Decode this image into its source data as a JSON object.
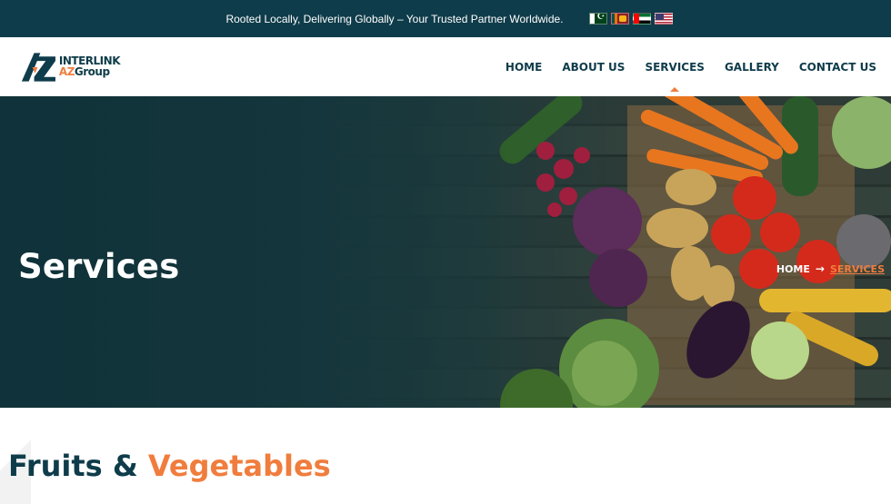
{
  "topbar": {
    "tagline": "Rooted Locally, Delivering Globally – Your Trusted Partner Worldwide.",
    "flags": [
      {
        "icon": "pakistan-flag-icon"
      },
      {
        "icon": "sri-lanka-flag-icon"
      },
      {
        "icon": "uae-flag-icon"
      },
      {
        "icon": "usa-flag-icon"
      }
    ]
  },
  "header": {
    "logo": {
      "line1": "INTERLINK",
      "line2_prefix": "AZ",
      "line2_suffix": "Group"
    },
    "nav": [
      {
        "label": "HOME"
      },
      {
        "label": "ABOUT US"
      },
      {
        "label": "SERVICES",
        "active": true
      },
      {
        "label": "GALLERY"
      },
      {
        "label": "CONTACT US"
      }
    ]
  },
  "hero": {
    "title": "Services",
    "breadcrumb": {
      "home": "HOME",
      "separator": "→",
      "current": "SERVICES"
    }
  },
  "section": {
    "title_part1": "Fruits",
    "title_amp": "&",
    "title_part2": "Vegetables"
  },
  "colors": {
    "primary": "#0f3c4a",
    "accent": "#f07d3d"
  }
}
